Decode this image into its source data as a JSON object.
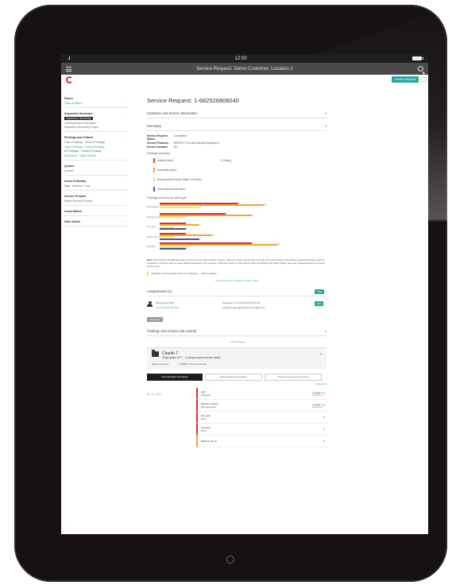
{
  "status_bar": {
    "signal": "..ıl",
    "time": "12:00"
  },
  "nav": {
    "title": "Service Request: Demo Customer, Location 1"
  },
  "header": {
    "new_request_label": "Service Request"
  },
  "sidebar": {
    "groups": [
      {
        "title": "Filters",
        "items": [
          {
            "label": "Clear all filters",
            "style": "link"
          }
        ]
      },
      {
        "title": "Inspection Summary",
        "items": [
          {
            "label": "Inspection Summary",
            "style": "active"
          },
          {
            "label": "Last Inspection Summary",
            "style": ""
          },
          {
            "label": "Inspection Summary Graph",
            "style": ""
          }
        ]
      },
      {
        "title": "Findings and Actions",
        "items": [
          {
            "label": "Open Findings · Closed Findings",
            "style": ""
          },
          {
            "label": "Open Findings / Closed Findings",
            "style": "link"
          },
          {
            "label": "All Findings · Closed Findings",
            "style": ""
          },
          {
            "label": "All Actions · Open Actions",
            "style": "link"
          }
        ]
      },
      {
        "title": "Quotes",
        "items": [
          {
            "label": "Quotes",
            "style": ""
          }
        ]
      },
      {
        "title": "Asset Criticality",
        "items": [
          {
            "label": "High · Medium · Low",
            "style": ""
          }
        ]
      },
      {
        "title": "Service Product",
        "items": [
          {
            "label": "Select Service Product",
            "style": ""
          }
        ]
      },
      {
        "title": "Asset Status",
        "items": []
      },
      {
        "title": "Date Added",
        "items": []
      }
    ]
  },
  "main": {
    "title": "Service Request: 1-682526806040",
    "customer_section": "Customer and Service Information",
    "summary_section": "Summary",
    "summary": [
      {
        "key": "Service Request Status",
        "value": "Completed"
      },
      {
        "key": "Service Products",
        "value": "INSPECT Fire and Security Equipment"
      },
      {
        "key": "Service Duration",
        "value": "45"
      }
    ],
    "findings_summary_title": "Findings summary",
    "legend": [
      {
        "label": "Safety Critical",
        "color": "#d6303a",
        "right": "1 Finding"
      },
      {
        "label": "Immediate Action",
        "color": "#f0a531",
        "right": ""
      },
      {
        "label": "Recommended action within 12 months",
        "color": "#f2e94e",
        "right": ""
      },
      {
        "label": "Informational observation",
        "color": "#4a4f9a",
        "right": ""
      }
    ],
    "findings_chart_title": "Findings overview by asset type",
    "note_label": "Note:",
    "note_text": "The number of findings shown can be in the overall number of items, values or assets inspected and may vary depending on the service product that was used for inspection. Findings refer to observations reported by the engineer. Click the column in the chart to filter the findings list. Each finding has been categorised and is shown on the chart.",
    "hint_text": "Available recommended actions by category — click to display",
    "show_all_link": "Show all recommendations / Hide charts",
    "assignments_title": "Assignments (1)",
    "assignments_add": "Add",
    "assignment": {
      "name": "Mr Engineer NEO",
      "phone": "+44 (0) 1234 567 890",
      "assigned": "Assigned on: 03-04-2019 09:42 PM",
      "email": "engineer.name@company-example.com",
      "action": "Edit",
      "tag": "Completed"
    },
    "findings_section": "Findings and Actions (26 Assets)",
    "add_finding_link": "+ Add a finding",
    "group": {
      "title": "Charlie 7",
      "subtitle": "Single grade 2077 - 3 ceiling mounted smoke heads",
      "meta1": "Service Products",
      "meta2": "INSPECT Fire and Security",
      "btn1": "View all details and actions",
      "btn2": "Hide all assets and findings",
      "btn3": "Generate a report for this asset",
      "link": "Collapse all"
    },
    "finding_date": "03 - 04 - 2019",
    "findings": [
      {
        "title": "Light",
        "sub": "Damaged",
        "badge": "Quote",
        "tone": "red"
      },
      {
        "title": "Batteries missing",
        "sub": "Damaged parts",
        "badge": "Quote",
        "tone": "red"
      },
      {
        "title": "Test point",
        "sub": "Worn",
        "badge": "",
        "tone": "red"
      },
      {
        "title": "Test point",
        "sub": "Worn",
        "badge": "",
        "tone": "red"
      },
      {
        "title": "Batteries low (1)",
        "sub": "",
        "badge": "",
        "tone": "orange"
      }
    ]
  },
  "chart_data": {
    "type": "bar",
    "orientation": "horizontal",
    "categories": [
      "Extinguisher",
      "Emergency light",
      "Fire door",
      "Alarm panel",
      "Sprinkler"
    ],
    "series": [
      {
        "name": "Safety Critical",
        "color": "#d6303a",
        "values": [
          6,
          5,
          2,
          2,
          7
        ]
      },
      {
        "name": "Immediate Action",
        "color": "#f0a531",
        "values": [
          8,
          7,
          3,
          4,
          9
        ]
      },
      {
        "name": "Recommended action within 12 months",
        "color": "#f2e94e",
        "values": [
          3,
          2,
          1,
          1,
          2
        ]
      },
      {
        "name": "Informational observation",
        "color": "#4a4f9a",
        "values": [
          0,
          0,
          2,
          3,
          2
        ]
      }
    ],
    "xlim": [
      0,
      10
    ]
  }
}
